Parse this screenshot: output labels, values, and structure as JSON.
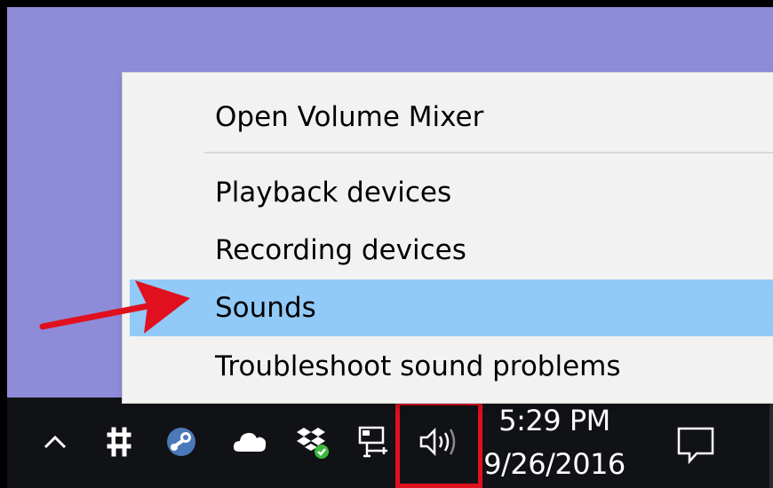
{
  "context_menu": {
    "items": [
      {
        "label": "Open Volume Mixer"
      },
      {
        "label": "Playback devices"
      },
      {
        "label": "Recording devices"
      },
      {
        "label": "Sounds",
        "selected": true
      },
      {
        "label": "Troubleshoot sound problems"
      }
    ]
  },
  "tray": {
    "icons": [
      "show-hidden-icons-chevron-icon",
      "tool-app-icon",
      "steam-icon",
      "onedrive-cloud-icon",
      "dropbox-icon",
      "network-icon",
      "volume-speaker-icon"
    ],
    "clock": {
      "time": "5:29 PM",
      "date": "9/26/2016"
    }
  },
  "colors": {
    "desktop_background": "#8e8bd8",
    "taskbar": "#111216",
    "menu_background": "#f2f2f2",
    "menu_selected": "#91c9f7",
    "annotation_red": "#e0101e",
    "sync_badge_green": "#3db83d"
  }
}
